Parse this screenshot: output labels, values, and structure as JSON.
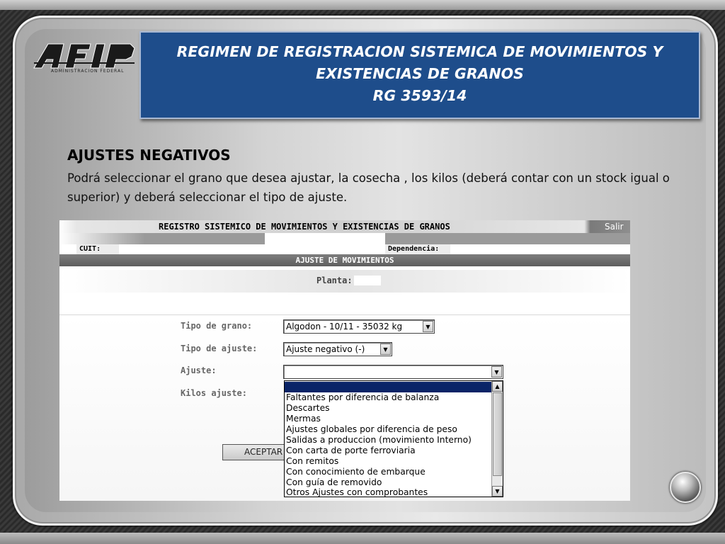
{
  "logo": {
    "text": "AFIP",
    "subtitle": "ADMINISTRACION FEDERAL"
  },
  "banner": {
    "line1": "REGIMEN DE REGISTRACION SISTEMICA DE MOVIMIENTOS Y",
    "line2": "EXISTENCIAS DE GRANOS",
    "line3": "RG  3593/14"
  },
  "section": {
    "title": "AJUSTES NEGATIVOS",
    "description": "Podrá seleccionar el grano que desea ajustar, la cosecha , los kilos (deberá contar con un stock igual o superior) y deberá seleccionar el tipo de ajuste."
  },
  "app": {
    "title": "REGISTRO SISTEMICO DE MOVIMIENTOS Y EXISTENCIAS DE GRANOS",
    "salir_label": "Salir",
    "cuit_label": "CUIT:",
    "dependencia_label": "Dependencia:",
    "subtitle": "AJUSTE DE MOVIMIENTOS",
    "planta_label": "Planta:",
    "form": {
      "tipo_grano_label": "Tipo de grano:",
      "tipo_grano_value": "Algodon - 10/11 - 35032 kg",
      "tipo_ajuste_label": "Tipo de ajuste:",
      "tipo_ajuste_value": "Ajuste negativo (-)",
      "ajuste_label": "Ajuste:",
      "ajuste_value": "",
      "kilos_label": "Kilos ajuste:",
      "accept_label": "ACEPTAR"
    },
    "ajuste_options": [
      "",
      "Faltantes por diferencia de balanza",
      "Descartes",
      "Mermas",
      "Ajustes globales por diferencia de peso",
      "Salidas a produccion (movimiento Interno)",
      "Con carta de porte ferroviaria",
      "Con remitos",
      "Con conocimiento de embarque",
      "Con guía de removido",
      "Otros Ajustes con comprobantes"
    ]
  }
}
